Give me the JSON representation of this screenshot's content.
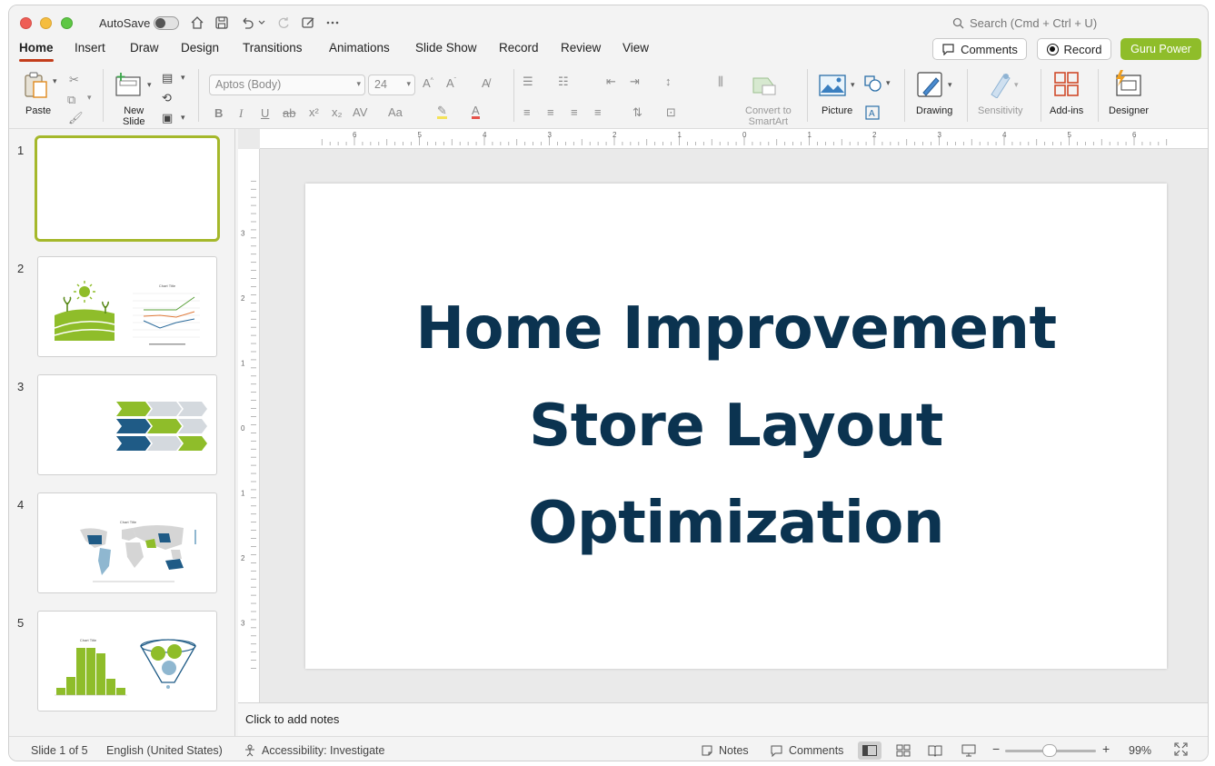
{
  "titlebar": {
    "autosave_label": "AutoSave",
    "search_placeholder": "Search (Cmd + Ctrl + U)"
  },
  "tabs": [
    "Home",
    "Insert",
    "Draw",
    "Design",
    "Transitions",
    "Animations",
    "Slide Show",
    "Record",
    "Review",
    "View"
  ],
  "active_tab": "Home",
  "header_buttons": {
    "comments": "Comments",
    "record": "Record",
    "guru": "Guru Power"
  },
  "ribbon": {
    "paste": "Paste",
    "new_slide_1": "New",
    "new_slide_2": "Slide",
    "font_name": "Aptos (Body)",
    "font_size": "24",
    "convert_1": "Convert to",
    "convert_2": "SmartArt",
    "picture": "Picture",
    "drawing": "Drawing",
    "sensitivity": "Sensitivity",
    "addins": "Add-ins",
    "designer": "Designer"
  },
  "ruler": {
    "h_ticks": [
      "6",
      "5",
      "4",
      "3",
      "2",
      "1",
      "0",
      "1",
      "2",
      "3",
      "4",
      "5",
      "6"
    ],
    "v_ticks": [
      "3",
      "2",
      "1",
      "0",
      "1",
      "2",
      "3"
    ]
  },
  "thumbnails": [
    {
      "num": "1"
    },
    {
      "num": "2",
      "chart_title": "Chart Title"
    },
    {
      "num": "3"
    },
    {
      "num": "4",
      "chart_title": "Chart Title"
    },
    {
      "num": "5",
      "chart_title": "Chart Title"
    }
  ],
  "slide": {
    "title": "Home Improvement\nStore Layout\nOptimization"
  },
  "notes_placeholder": "Click to add notes",
  "status": {
    "slide_info": "Slide 1 of 5",
    "language": "English (United States)",
    "accessibility": "Accessibility: Investigate",
    "notes": "Notes",
    "comments": "Comments",
    "zoom": "99%"
  },
  "colors": {
    "title_text": "#0b3350",
    "accent_green": "#8fbd2a",
    "accent_blue": "#1f5b86",
    "tab_underline": "#c43e1c"
  }
}
